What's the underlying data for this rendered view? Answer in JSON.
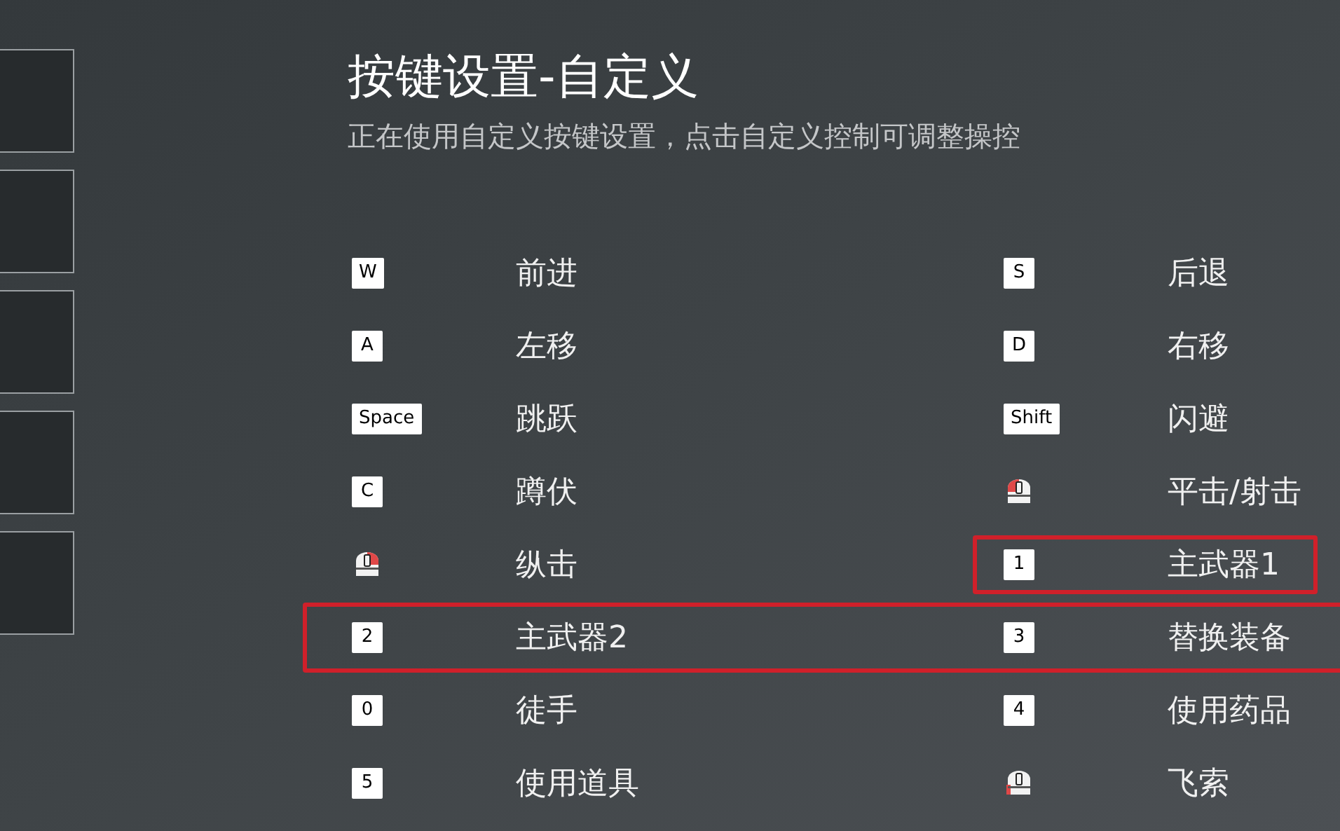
{
  "title": "按键设置-自定义",
  "subtitle": "正在使用自定义按键设置，点击自定义控制可调整操控",
  "rows": [
    {
      "highlighted": false,
      "bindings": [
        {
          "kind": "key",
          "key": "W",
          "action": "前进",
          "highlighted": false
        },
        {
          "kind": "key",
          "key": "S",
          "action": "后退",
          "highlighted": false
        }
      ]
    },
    {
      "highlighted": false,
      "bindings": [
        {
          "kind": "key",
          "key": "A",
          "action": "左移",
          "highlighted": false
        },
        {
          "kind": "key",
          "key": "D",
          "action": "右移",
          "highlighted": false
        }
      ]
    },
    {
      "highlighted": false,
      "bindings": [
        {
          "kind": "key",
          "key": "Space",
          "action": "跳跃",
          "highlighted": false
        },
        {
          "kind": "key",
          "key": "Shift",
          "action": "闪避",
          "highlighted": false
        }
      ]
    },
    {
      "highlighted": false,
      "bindings": [
        {
          "kind": "key",
          "key": "C",
          "action": "蹲伏",
          "highlighted": false
        },
        {
          "kind": "mouse_left",
          "action": "平击/射击",
          "highlighted": false
        }
      ]
    },
    {
      "highlighted": false,
      "bindings": [
        {
          "kind": "mouse_right",
          "action": "纵击",
          "highlighted": false
        },
        {
          "kind": "key",
          "key": "1",
          "action": "主武器1",
          "highlighted": true
        }
      ]
    },
    {
      "highlighted": true,
      "bindings": [
        {
          "kind": "key",
          "key": "2",
          "action": "主武器2",
          "highlighted": false
        },
        {
          "kind": "key",
          "key": "3",
          "action": "替换装备",
          "highlighted": false
        }
      ]
    },
    {
      "highlighted": false,
      "bindings": [
        {
          "kind": "key",
          "key": "0",
          "action": "徒手",
          "highlighted": false
        },
        {
          "kind": "key",
          "key": "4",
          "action": "使用药品",
          "highlighted": false
        }
      ]
    },
    {
      "highlighted": false,
      "bindings": [
        {
          "kind": "key",
          "key": "5",
          "action": "使用道具",
          "highlighted": false
        },
        {
          "kind": "mouse_side",
          "action": "飞索",
          "highlighted": false
        }
      ]
    }
  ]
}
